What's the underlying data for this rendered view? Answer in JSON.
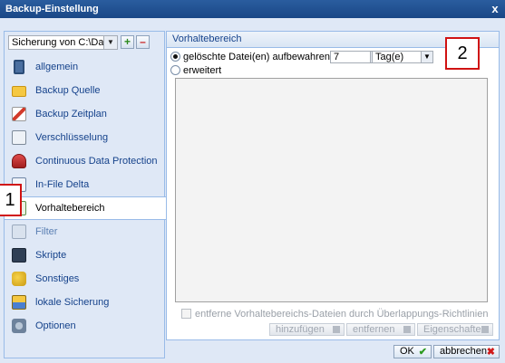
{
  "window": {
    "title": "Backup-Einstellung",
    "close_label": "x"
  },
  "sidebar": {
    "source_select": "Sicherung von C:\\Daten",
    "add_label": "+",
    "remove_label": "–",
    "items": [
      {
        "label": "allgemein",
        "icon": "phone-icon"
      },
      {
        "label": "Backup Quelle",
        "icon": "folder-icon"
      },
      {
        "label": "Backup Zeitplan",
        "icon": "schedule-icon"
      },
      {
        "label": "Verschlüsselung",
        "icon": "lock-document-icon"
      },
      {
        "label": "Continuous Data Protection",
        "icon": "shield-icon"
      },
      {
        "label": "In-File Delta",
        "icon": "file-icon"
      },
      {
        "label": "Vorhaltebereich",
        "icon": "archive-icon"
      },
      {
        "label": "Filter",
        "icon": "filter-icon"
      },
      {
        "label": "Skripte",
        "icon": "script-icon"
      },
      {
        "label": "Sonstiges",
        "icon": "misc-icon"
      },
      {
        "label": "lokale Sicherung",
        "icon": "local-backup-icon"
      },
      {
        "label": "Optionen",
        "icon": "options-icon"
      }
    ]
  },
  "main": {
    "header": "Vorhaltebereich",
    "radio1_label": "gelöschte Datei(en) aufbewahren für",
    "days_value": "7",
    "unit_value": "Tag(e)",
    "radio2_label": "erweitert",
    "checkbox_label": "entferne Vorhaltebereichs-Dateien durch Überlappungs-Richtlinien",
    "btn_add": "hinzufügen",
    "btn_remove": "entfernen",
    "btn_props": "Eigenschaften"
  },
  "footer": {
    "ok": "OK",
    "cancel": "abbrechen"
  },
  "markers": {
    "m1": "1",
    "m2": "2"
  }
}
